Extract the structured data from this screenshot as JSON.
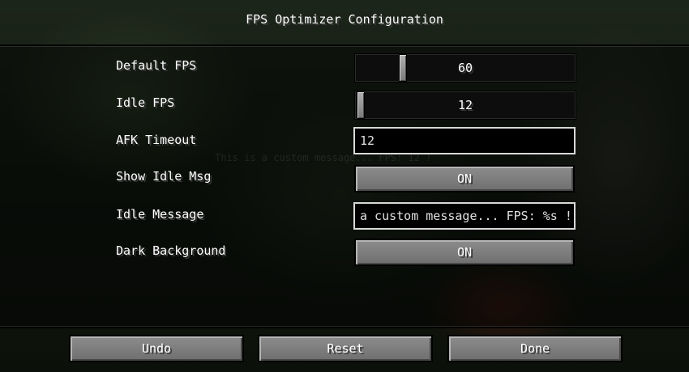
{
  "background_text": "This is a custom message... FPS: 12 !",
  "title": "FPS Optimizer Configuration",
  "settings": [
    {
      "label": "Default FPS",
      "type": "slider",
      "value": "60",
      "fraction": 0.2
    },
    {
      "label": "Idle FPS",
      "type": "slider",
      "value": "12",
      "fraction": 0.0
    },
    {
      "label": "AFK Timeout",
      "type": "text",
      "value": "12"
    },
    {
      "label": "Show Idle Msg",
      "type": "toggle",
      "value": "ON"
    },
    {
      "label": "Idle Message",
      "type": "text",
      "value": "a custom message... FPS: %s !"
    },
    {
      "label": "Dark Background",
      "type": "toggle",
      "value": "ON"
    }
  ],
  "buttons": {
    "undo": "Undo",
    "reset": "Reset",
    "done": "Done"
  },
  "colors": {
    "button_face": "#7f7f7f",
    "text": "#ffffff",
    "field_border": "#d8d8d8"
  }
}
